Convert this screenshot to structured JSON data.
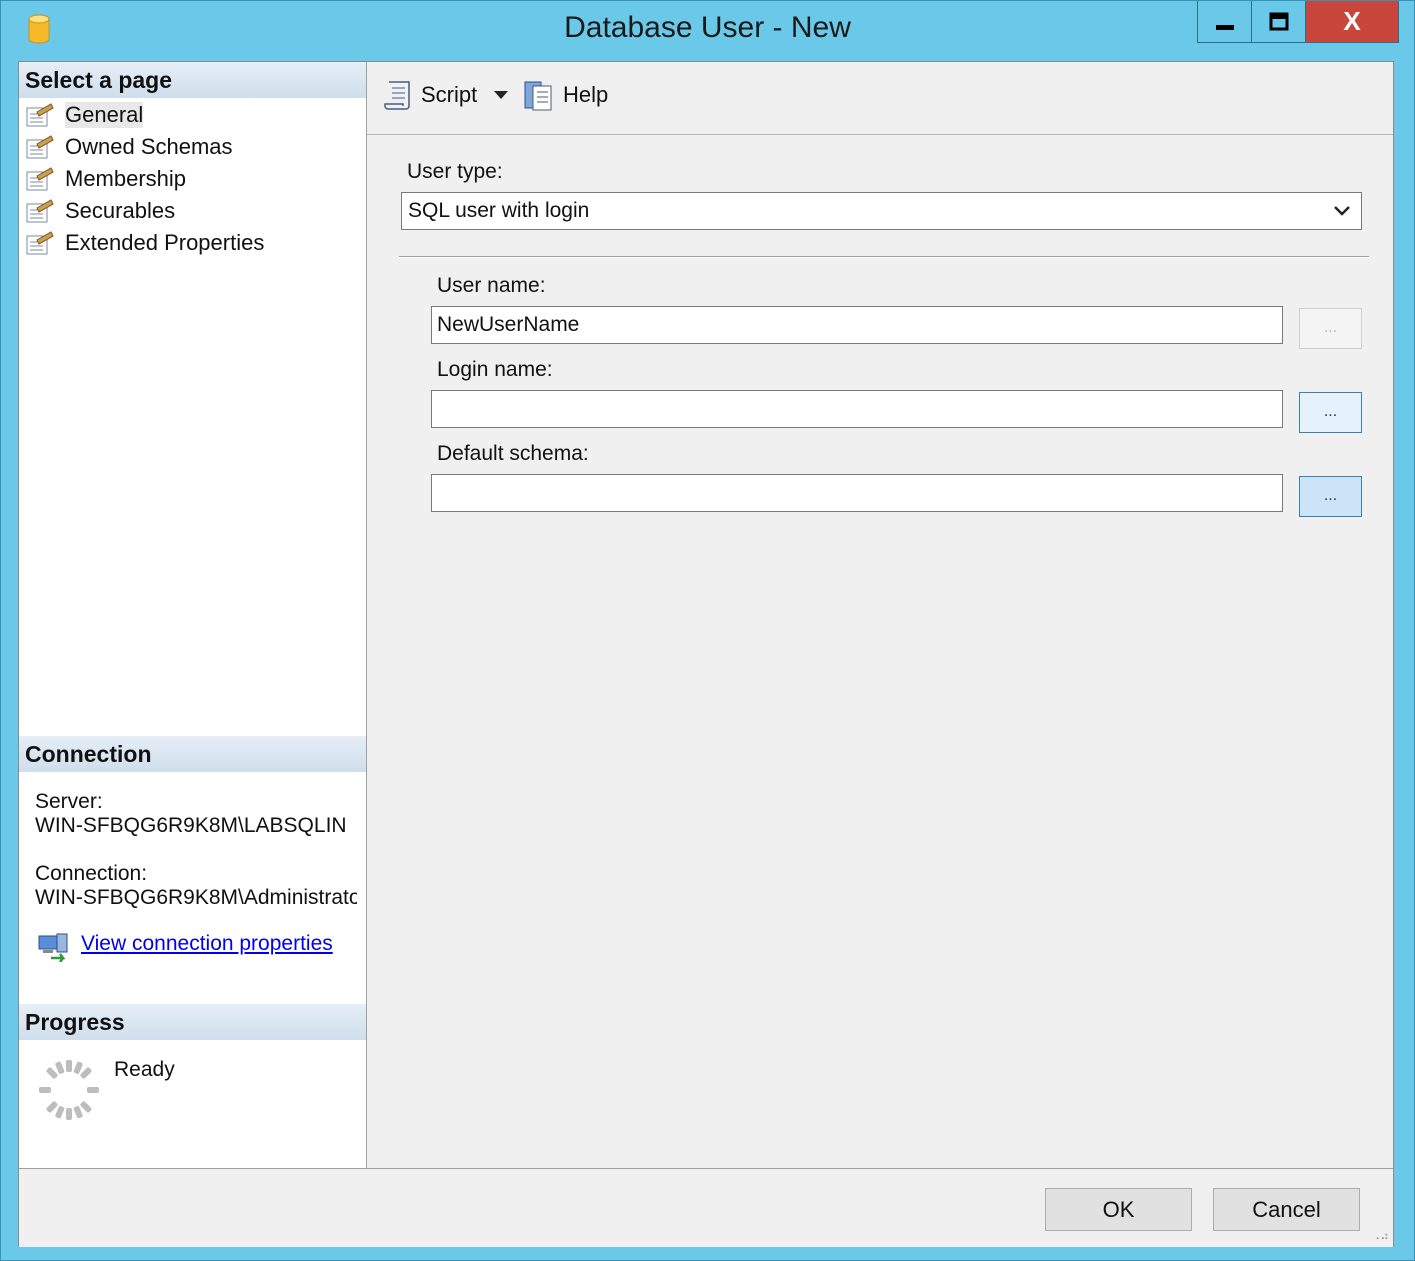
{
  "window": {
    "title": "Database User - New",
    "close_label": "X"
  },
  "left_pane": {
    "select_page_header": "Select a page",
    "pages": [
      {
        "label": "General",
        "selected": true
      },
      {
        "label": "Owned Schemas"
      },
      {
        "label": "Membership"
      },
      {
        "label": "Securables"
      },
      {
        "label": "Extended Properties"
      }
    ],
    "connection_header": "Connection",
    "server_label": "Server:",
    "server_value": "WIN-SFBQG6R9K8M\\LABSQLIN",
    "connection_label": "Connection:",
    "connection_value": "WIN-SFBQG6R9K8M\\Administrato",
    "view_connection_link": "View connection properties",
    "progress_header": "Progress",
    "progress_status": "Ready"
  },
  "toolbar": {
    "script_label": "Script",
    "help_label": "Help"
  },
  "form": {
    "user_type_label": "User type:",
    "user_type_value": "SQL user with login",
    "user_name_label": "User name:",
    "user_name_value": "NewUserName",
    "login_name_label": "Login name:",
    "login_name_value": "",
    "default_schema_label": "Default schema:",
    "default_schema_value": "",
    "browse_label": "..."
  },
  "footer": {
    "ok_label": "OK",
    "cancel_label": "Cancel"
  },
  "colors": {
    "title_bar": "#6ac9e9",
    "close_button": "#c9463d",
    "section_header": "#d5e2ef",
    "link": "#0000ee"
  },
  "icons": [
    "database-icon",
    "minimize-icon",
    "maximize-icon",
    "close-icon",
    "page-icon",
    "script-icon",
    "dropdown-arrow-icon",
    "help-icon",
    "connection-properties-icon",
    "progress-spinner-icon",
    "resize-grip-icon"
  ]
}
